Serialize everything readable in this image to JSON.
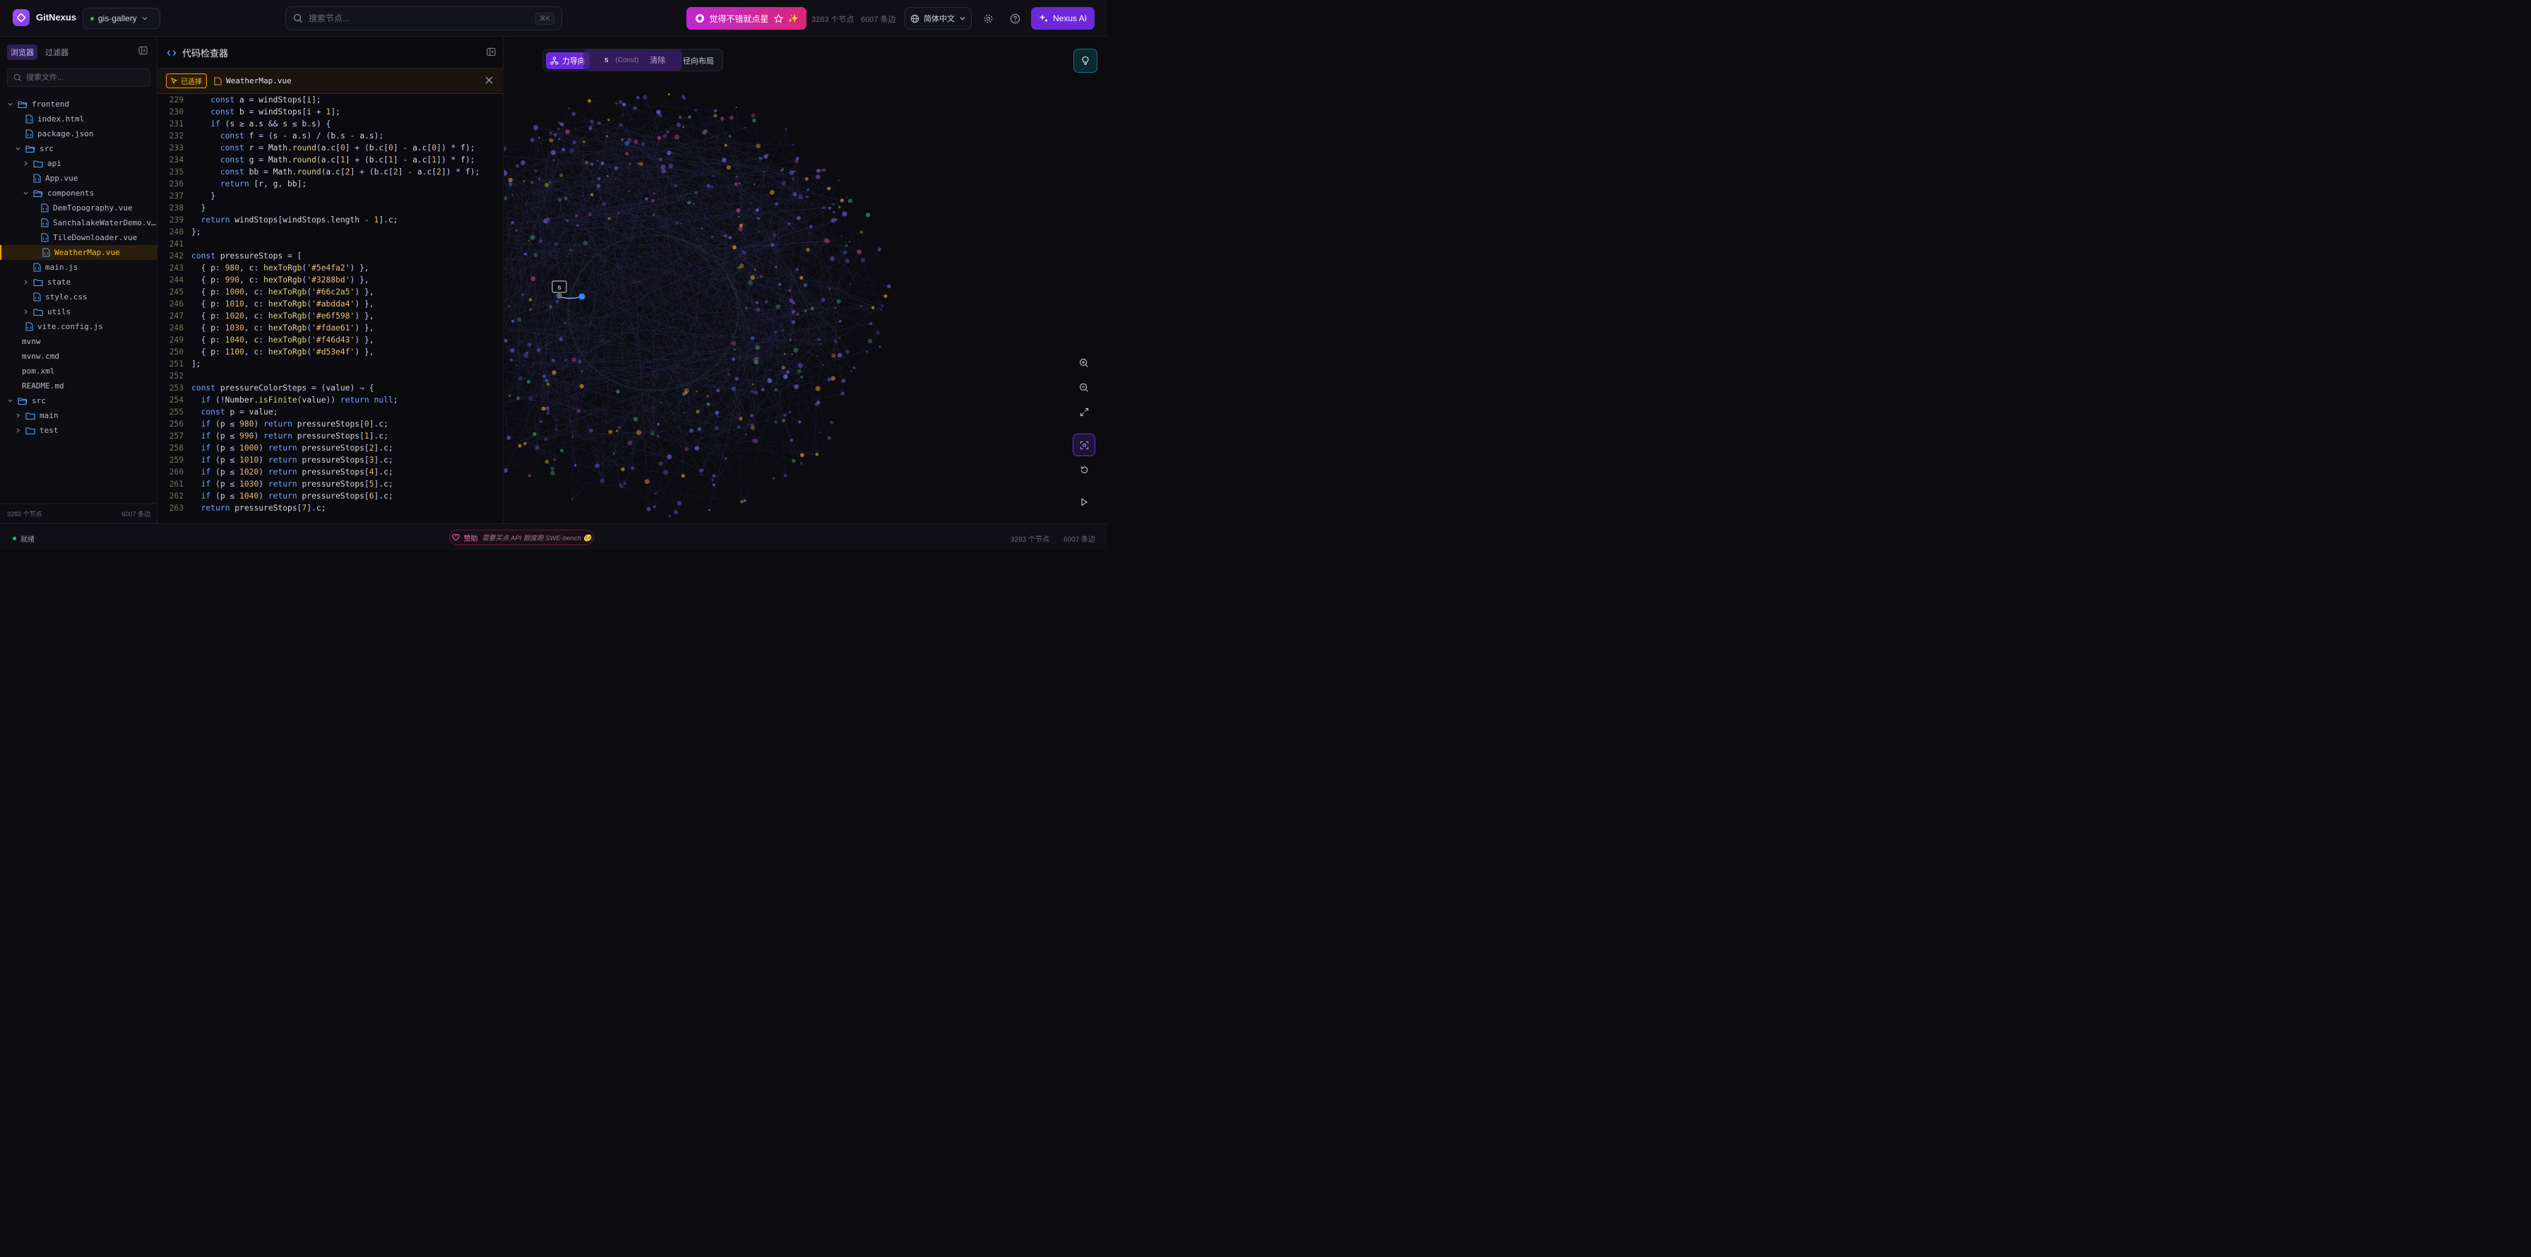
{
  "topbar": {
    "app_name": "GitNexus",
    "repo": "gis-gallery",
    "search_placeholder": "搜索节点...",
    "search_shortcut": "⌘K",
    "star_label": "觉得不错就点星",
    "nodes": "3283 个节点",
    "edges": "6007 条边",
    "language": "简体中文",
    "ai_label": "Nexus AI"
  },
  "sidebar": {
    "tabs": [
      "浏览器",
      "过滤器"
    ],
    "search_placeholder": "搜索文件...",
    "tree": [
      {
        "label": "frontend",
        "type": "folder",
        "open": true,
        "depth": 0
      },
      {
        "label": "index.html",
        "type": "file",
        "depth": 1
      },
      {
        "label": "package.json",
        "type": "file",
        "depth": 1
      },
      {
        "label": "src",
        "type": "folder",
        "open": true,
        "depth": 1
      },
      {
        "label": "api",
        "type": "folder",
        "open": false,
        "depth": 2
      },
      {
        "label": "App.vue",
        "type": "file",
        "depth": 2
      },
      {
        "label": "components",
        "type": "folder",
        "open": true,
        "depth": 2
      },
      {
        "label": "DemTopography.vue",
        "type": "file",
        "depth": 3
      },
      {
        "label": "SanchalakeWaterDemo.v…",
        "type": "file",
        "depth": 3
      },
      {
        "label": "TileDownloader.vue",
        "type": "file",
        "depth": 3
      },
      {
        "label": "WeatherMap.vue",
        "type": "file",
        "depth": 3,
        "selected": true
      },
      {
        "label": "main.js",
        "type": "file",
        "depth": 2
      },
      {
        "label": "state",
        "type": "folder",
        "open": false,
        "depth": 2
      },
      {
        "label": "style.css",
        "type": "file",
        "depth": 2
      },
      {
        "label": "utils",
        "type": "folder",
        "open": false,
        "depth": 2
      },
      {
        "label": "vite.config.js",
        "type": "file",
        "depth": 1
      },
      {
        "label": "mvnw",
        "type": "file-plain",
        "depth": 0
      },
      {
        "label": "mvnw.cmd",
        "type": "file-plain",
        "depth": 0
      },
      {
        "label": "pom.xml",
        "type": "file-plain",
        "depth": 0
      },
      {
        "label": "README.md",
        "type": "file-plain",
        "depth": 0
      },
      {
        "label": "src",
        "type": "folder",
        "open": true,
        "depth": 0
      },
      {
        "label": "main",
        "type": "folder",
        "open": false,
        "depth": 1
      },
      {
        "label": "test",
        "type": "folder",
        "open": false,
        "depth": 1
      }
    ],
    "footer_nodes": "3283 个节点",
    "footer_edges": "6007 条边"
  },
  "inspector": {
    "title": "代码检查器",
    "selected_badge": "已选择",
    "file_name": "WeatherMap.vue",
    "lines": [
      {
        "n": "229",
        "code": "    const a = windStops[i];"
      },
      {
        "n": "230",
        "code": "    const b = windStops[i + 1];"
      },
      {
        "n": "231",
        "code": "    if (s ≥ a.s && s ≤ b.s) {"
      },
      {
        "n": "232",
        "code": "      const f = (s - a.s) / (b.s - a.s);"
      },
      {
        "n": "233",
        "code": "      const r = Math.round(a.c[0] + (b.c[0] - a.c[0]) * f);"
      },
      {
        "n": "234",
        "code": "      const g = Math.round(a.c[1] + (b.c[1] - a.c[1]) * f);"
      },
      {
        "n": "235",
        "code": "      const bb = Math.round(a.c[2] + (b.c[2] - a.c[2]) * f);"
      },
      {
        "n": "236",
        "code": "      return [r, g, bb];"
      },
      {
        "n": "237",
        "code": "    }"
      },
      {
        "n": "238",
        "code": "  }"
      },
      {
        "n": "239",
        "code": "  return windStops[windStops.length - 1].c;"
      },
      {
        "n": "240",
        "code": "};"
      },
      {
        "n": "241",
        "code": ""
      },
      {
        "n": "242",
        "code": "const pressureStops = ["
      },
      {
        "n": "243",
        "code": "  { p: 980, c: hexToRgb('#5e4fa2') },"
      },
      {
        "n": "244",
        "code": "  { p: 990, c: hexToRgb('#3288bd') },"
      },
      {
        "n": "245",
        "code": "  { p: 1000, c: hexToRgb('#66c2a5') },"
      },
      {
        "n": "246",
        "code": "  { p: 1010, c: hexToRgb('#abdda4') },"
      },
      {
        "n": "247",
        "code": "  { p: 1020, c: hexToRgb('#e6f598') },"
      },
      {
        "n": "248",
        "code": "  { p: 1030, c: hexToRgb('#fdae61') },"
      },
      {
        "n": "249",
        "code": "  { p: 1040, c: hexToRgb('#f46d43') },"
      },
      {
        "n": "250",
        "code": "  { p: 1100, c: hexToRgb('#d53e4f') },"
      },
      {
        "n": "251",
        "code": "];"
      },
      {
        "n": "252",
        "code": ""
      },
      {
        "n": "253",
        "code": "const pressureColorSteps = (value) ⇒ {"
      },
      {
        "n": "254",
        "code": "  if (!Number.isFinite(value)) return null;"
      },
      {
        "n": "255",
        "code": "  const p = value;"
      },
      {
        "n": "256",
        "code": "  if (p ≤ 980) return pressureStops[0].c;"
      },
      {
        "n": "257",
        "code": "  if (p ≤ 990) return pressureStops[1].c;"
      },
      {
        "n": "258",
        "code": "  if (p ≤ 1000) return pressureStops[2].c;"
      },
      {
        "n": "259",
        "code": "  if (p ≤ 1010) return pressureStops[3].c;"
      },
      {
        "n": "260",
        "code": "  if (p ≤ 1020) return pressureStops[4].c;"
      },
      {
        "n": "261",
        "code": "  if (p ≤ 1030) return pressureStops[5].c;"
      },
      {
        "n": "262",
        "code": "  if (p ≤ 1040) return pressureStops[6].c;"
      },
      {
        "n": "263",
        "code": "  return pressureStops[7].c;"
      }
    ]
  },
  "graph": {
    "layout_force": "力导向",
    "layout_radial": "径向布局",
    "selected_node": "s",
    "selected_kind": "(Const)",
    "clear_label": "清除",
    "node_label": "s"
  },
  "statusbar": {
    "ready": "就绪",
    "sponsor": "赞助",
    "sponsor_note": "需要买点 API 额度跑 SWE-bench 🥺",
    "nodes": "3283 个节点",
    "edges": "6007 条边"
  },
  "colors": {
    "accent": "#6d28d9",
    "selected": "#f59e0b",
    "star": "#db2777"
  }
}
